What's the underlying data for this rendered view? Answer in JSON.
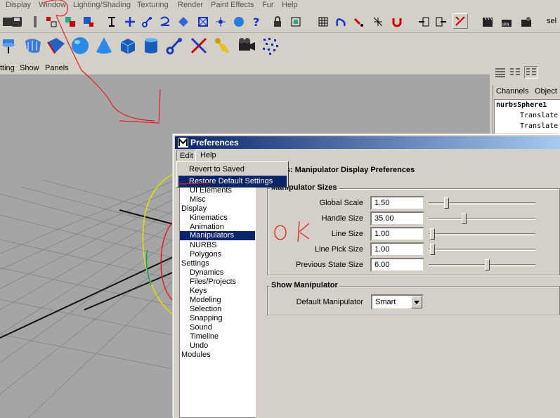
{
  "menubar": [
    "Display",
    "Window",
    "Lighting/Shading",
    "Texturing",
    "Render",
    "Paint Effects",
    "Fur",
    "Help"
  ],
  "toolbar_right_text": "sel",
  "panel_menu": [
    "tting",
    "Show",
    "Panels"
  ],
  "channel_box": {
    "tabs": [
      "Channels",
      "Object"
    ],
    "object_name": "nurbsSphere1",
    "rows": [
      "Translate",
      "Translate"
    ]
  },
  "window": {
    "title": "Preferences",
    "menu": [
      "Edit",
      "Help"
    ],
    "dropdown": [
      "Revert to Saved",
      "Restore Default Settings"
    ],
    "header": "lators: Manipulator Display Preferences"
  },
  "tree": [
    {
      "label": "UI Elements",
      "indent": 1
    },
    {
      "label": "Misc",
      "indent": 1
    },
    {
      "label": "Display",
      "indent": 0
    },
    {
      "label": "Kinematics",
      "indent": 1
    },
    {
      "label": "Animation",
      "indent": 1
    },
    {
      "label": "Manipulators",
      "indent": 1,
      "selected": true
    },
    {
      "label": "NURBS",
      "indent": 1
    },
    {
      "label": "Polygons",
      "indent": 1
    },
    {
      "label": "Settings",
      "indent": 0
    },
    {
      "label": "Dynamics",
      "indent": 1
    },
    {
      "label": "Files/Projects",
      "indent": 1
    },
    {
      "label": "Keys",
      "indent": 1
    },
    {
      "label": "Modeling",
      "indent": 1
    },
    {
      "label": "Selection",
      "indent": 1
    },
    {
      "label": "Snapping",
      "indent": 1
    },
    {
      "label": "Sound",
      "indent": 1
    },
    {
      "label": "Timeline",
      "indent": 1
    },
    {
      "label": "Undo",
      "indent": 1
    },
    {
      "label": "Modules",
      "indent": 0
    }
  ],
  "sizes_group": {
    "label": "Manipulator Sizes",
    "fields": [
      {
        "label": "Global Scale",
        "value": "1.50",
        "slider": 0.17
      },
      {
        "label": "Handle Size",
        "value": "35.00",
        "slider": 0.33
      },
      {
        "label": "Line Size",
        "value": "1.00",
        "slider": 0.0
      },
      {
        "label": "Line Pick Size",
        "value": "1.00",
        "slider": 0.0
      },
      {
        "label": "Previous State Size",
        "value": "6.00",
        "slider": 0.54
      }
    ]
  },
  "show_group": {
    "label": "Show Manipulator",
    "field_label": "Default Manipulator",
    "value": "Smart"
  },
  "annotation": {
    "text": "OK",
    "color": "#e02020"
  },
  "colors": {
    "title_start": "#0a246a",
    "title_end": "#a6caf0",
    "selection": "#0a246a",
    "face": "#d4d0c8",
    "viewport": "#a5a5a5"
  }
}
